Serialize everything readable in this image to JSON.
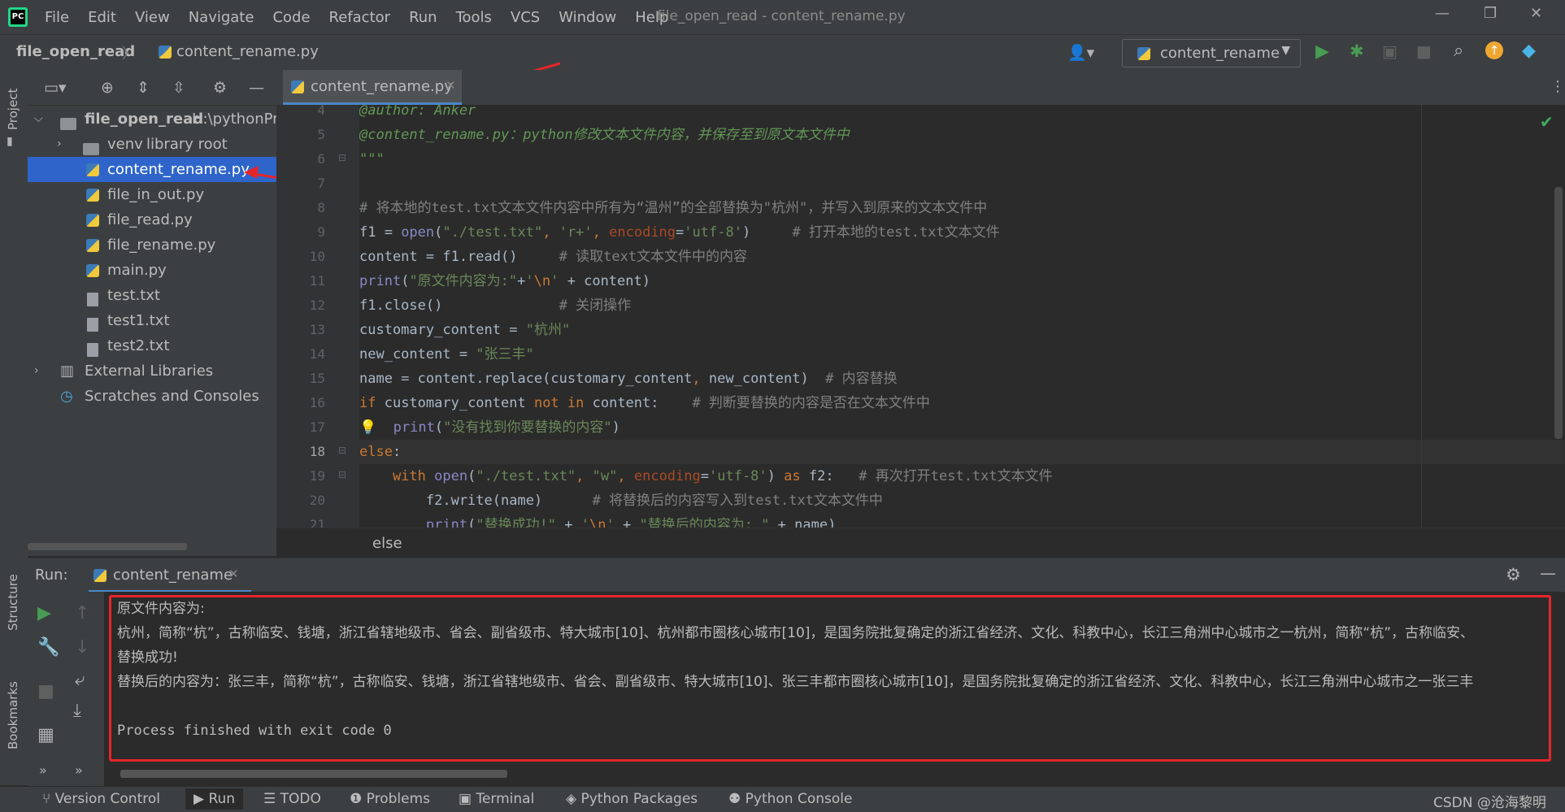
{
  "app": {
    "title": "file_open_read - content_rename.py",
    "logo": "PC",
    "menu": [
      "File",
      "Edit",
      "View",
      "Navigate",
      "Code",
      "Refactor",
      "Run",
      "Tools",
      "VCS",
      "Window",
      "Help"
    ]
  },
  "navbar": {
    "project": "file_open_read",
    "file": "content_rename.py",
    "run_config": "content_rename"
  },
  "project_panel": {
    "side_label": "Project",
    "tree": [
      {
        "label": "file_open_read",
        "hint": "H:\\pythonPro",
        "icon": "folder-icon"
      },
      {
        "label": "venv",
        "hint": "library root",
        "icon": "folder-icon"
      },
      {
        "label": "content_rename.py",
        "icon": "python-file-icon"
      },
      {
        "label": "file_in_out.py",
        "icon": "python-file-icon"
      },
      {
        "label": "file_read.py",
        "icon": "python-file-icon"
      },
      {
        "label": "file_rename.py",
        "icon": "python-file-icon"
      },
      {
        "label": "main.py",
        "icon": "python-file-icon"
      },
      {
        "label": "test.txt",
        "icon": "text-file-icon"
      },
      {
        "label": "test1.txt",
        "icon": "text-file-icon"
      },
      {
        "label": "test2.txt",
        "icon": "text-file-icon"
      },
      {
        "label": "External Libraries",
        "icon": "library-icon"
      },
      {
        "label": "Scratches and Consoles",
        "icon": "scratches-icon"
      }
    ]
  },
  "editor": {
    "tab": "content_rename.py",
    "line_numbers": [
      "4",
      "5",
      "6",
      "7",
      "8",
      "9",
      "10",
      "11",
      "12",
      "13",
      "14",
      "15",
      "16",
      "17",
      "18",
      "19",
      "20",
      "21"
    ],
    "current_line": "18",
    "breadcrumb": "else"
  },
  "run_panel": {
    "label": "Run:",
    "tab": "content_rename",
    "output": [
      "原文件内容为:",
      "杭州，简称“杭”，古称临安、钱塘，浙江省辖地级市、省会、副省级市、特大城市[10]、杭州都市圈核心城市[10]，是国务院批复确定的浙江省经济、文化、科教中心，长江三角洲中心城市之一杭州，简称“杭”，古称临安、",
      "替换成功!",
      "替换后的内容为：张三丰，简称“杭”，古称临安、钱塘，浙江省辖地级市、省会、副省级市、特大城市[10]、张三丰都市圈核心城市[10]，是国务院批复确定的浙江省经济、文化、科教中心，长江三角洲中心城市之一张三丰",
      "",
      "Process finished with exit code 0"
    ]
  },
  "left_strip": {
    "structure": "Structure",
    "bookmarks": "Bookmarks"
  },
  "statusbar": {
    "items": [
      "Version Control",
      "Run",
      "TODO",
      "Problems",
      "Terminal",
      "Python Packages",
      "Python Console"
    ],
    "watermark": "CSDN @沧海黎明"
  }
}
